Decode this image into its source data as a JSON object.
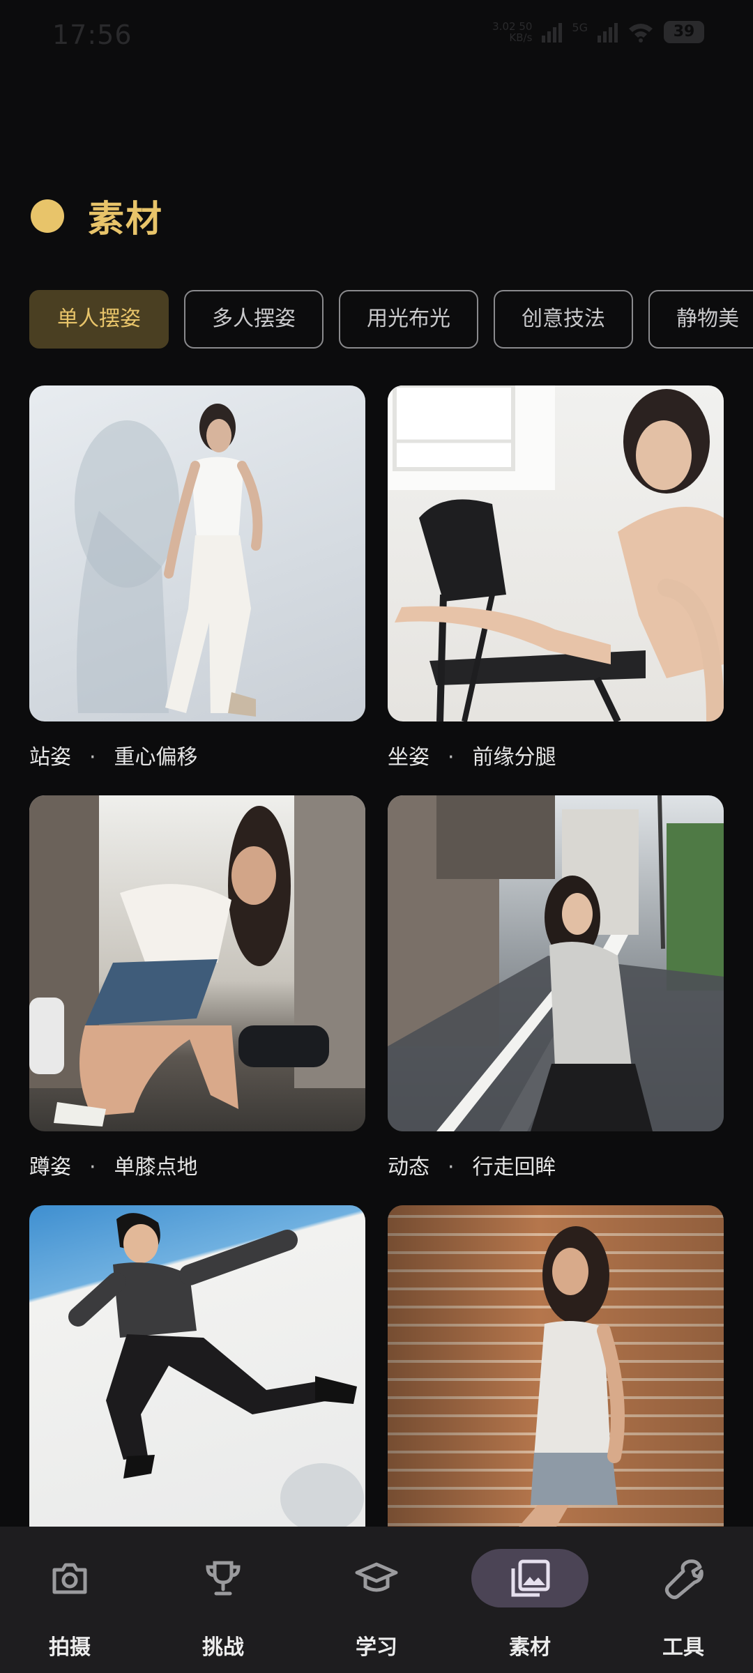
{
  "status_bar": {
    "time": "17:56",
    "net_speed_value": "3.02 50",
    "net_speed_unit": "KB/s",
    "signal_label": "5G",
    "battery": "39"
  },
  "section": {
    "title": "素材",
    "accent_color": "#e8c46a"
  },
  "tabs": [
    {
      "label": "单人摆姿",
      "active": true
    },
    {
      "label": "多人摆姿",
      "active": false
    },
    {
      "label": "用光布光",
      "active": false
    },
    {
      "label": "创意技法",
      "active": false
    },
    {
      "label": "静物美",
      "active": false
    }
  ],
  "cards": [
    {
      "category": "站姿",
      "name": "重心偏移",
      "separator": "·"
    },
    {
      "category": "坐姿",
      "name": "前缘分腿",
      "separator": "·"
    },
    {
      "category": "蹲姿",
      "name": "单膝点地",
      "separator": "·"
    },
    {
      "category": "动态",
      "name": "行走回眸",
      "separator": "·"
    },
    {
      "category": "",
      "name": "",
      "separator": ""
    },
    {
      "category": "",
      "name": "",
      "separator": ""
    }
  ],
  "bottom_nav": [
    {
      "label": "拍摄",
      "icon": "camera-icon",
      "active": false
    },
    {
      "label": "挑战",
      "icon": "trophy-icon",
      "active": false
    },
    {
      "label": "学习",
      "icon": "graduation-cap-icon",
      "active": false
    },
    {
      "label": "素材",
      "icon": "gallery-icon",
      "active": true
    },
    {
      "label": "工具",
      "icon": "wrench-icon",
      "active": false
    }
  ]
}
